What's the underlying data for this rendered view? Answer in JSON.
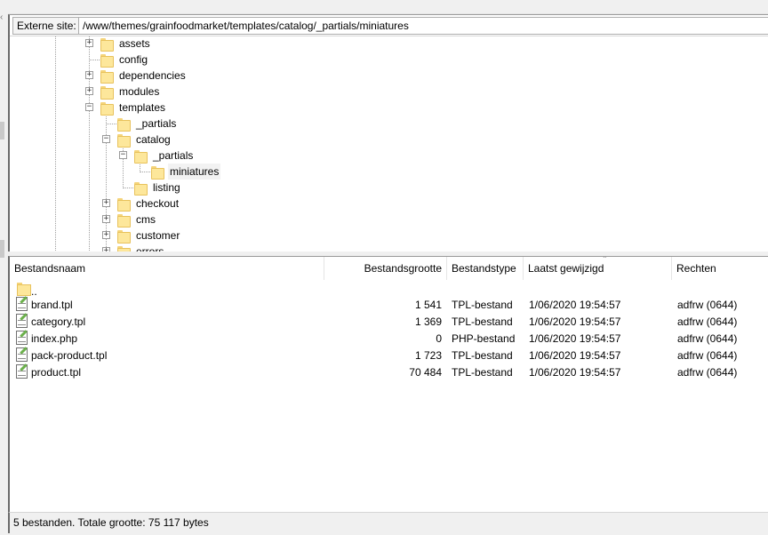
{
  "remote_site": {
    "label": "Externe site:",
    "path": "/www/themes/grainfoodmarket/templates/catalog/_partials/miniatures"
  },
  "tree": {
    "items": [
      {
        "label": "assets",
        "expander": "+"
      },
      {
        "label": "config",
        "expander": ""
      },
      {
        "label": "dependencies",
        "expander": "+"
      },
      {
        "label": "modules",
        "expander": "+"
      },
      {
        "label": "templates",
        "expander": "−"
      },
      {
        "label": "_partials",
        "expander": ""
      },
      {
        "label": "catalog",
        "expander": "−"
      },
      {
        "label": "_partials",
        "expander": "−"
      },
      {
        "label": "miniatures",
        "expander": "",
        "selected": true
      },
      {
        "label": "listing",
        "expander": ""
      },
      {
        "label": "checkout",
        "expander": "+"
      },
      {
        "label": "cms",
        "expander": "+"
      },
      {
        "label": "customer",
        "expander": "+"
      },
      {
        "label": "errors",
        "expander": "+"
      }
    ]
  },
  "file_list": {
    "columns": {
      "name": "Bestandsnaam",
      "size": "Bestandsgrootte",
      "type": "Bestandstype",
      "modified": "Laatst gewijzigd",
      "perms": "Rechten"
    },
    "parent_label": "..",
    "rows": [
      {
        "name": "brand.tpl",
        "size": "1 541",
        "type": "TPL-bestand",
        "modified": "1/06/2020 19:54:57",
        "perms": "adfrw (0644)"
      },
      {
        "name": "category.tpl",
        "size": "1 369",
        "type": "TPL-bestand",
        "modified": "1/06/2020 19:54:57",
        "perms": "adfrw (0644)"
      },
      {
        "name": "index.php",
        "size": "0",
        "type": "PHP-bestand",
        "modified": "1/06/2020 19:54:57",
        "perms": "adfrw (0644)"
      },
      {
        "name": "pack-product.tpl",
        "size": "1 723",
        "type": "TPL-bestand",
        "modified": "1/06/2020 19:54:57",
        "perms": "adfrw (0644)"
      },
      {
        "name": "product.tpl",
        "size": "70 484",
        "type": "TPL-bestand",
        "modified": "1/06/2020 19:54:57",
        "perms": "adfrw (0644)"
      }
    ]
  },
  "status": {
    "text": "5 bestanden. Totale grootte: 75 117 bytes"
  }
}
